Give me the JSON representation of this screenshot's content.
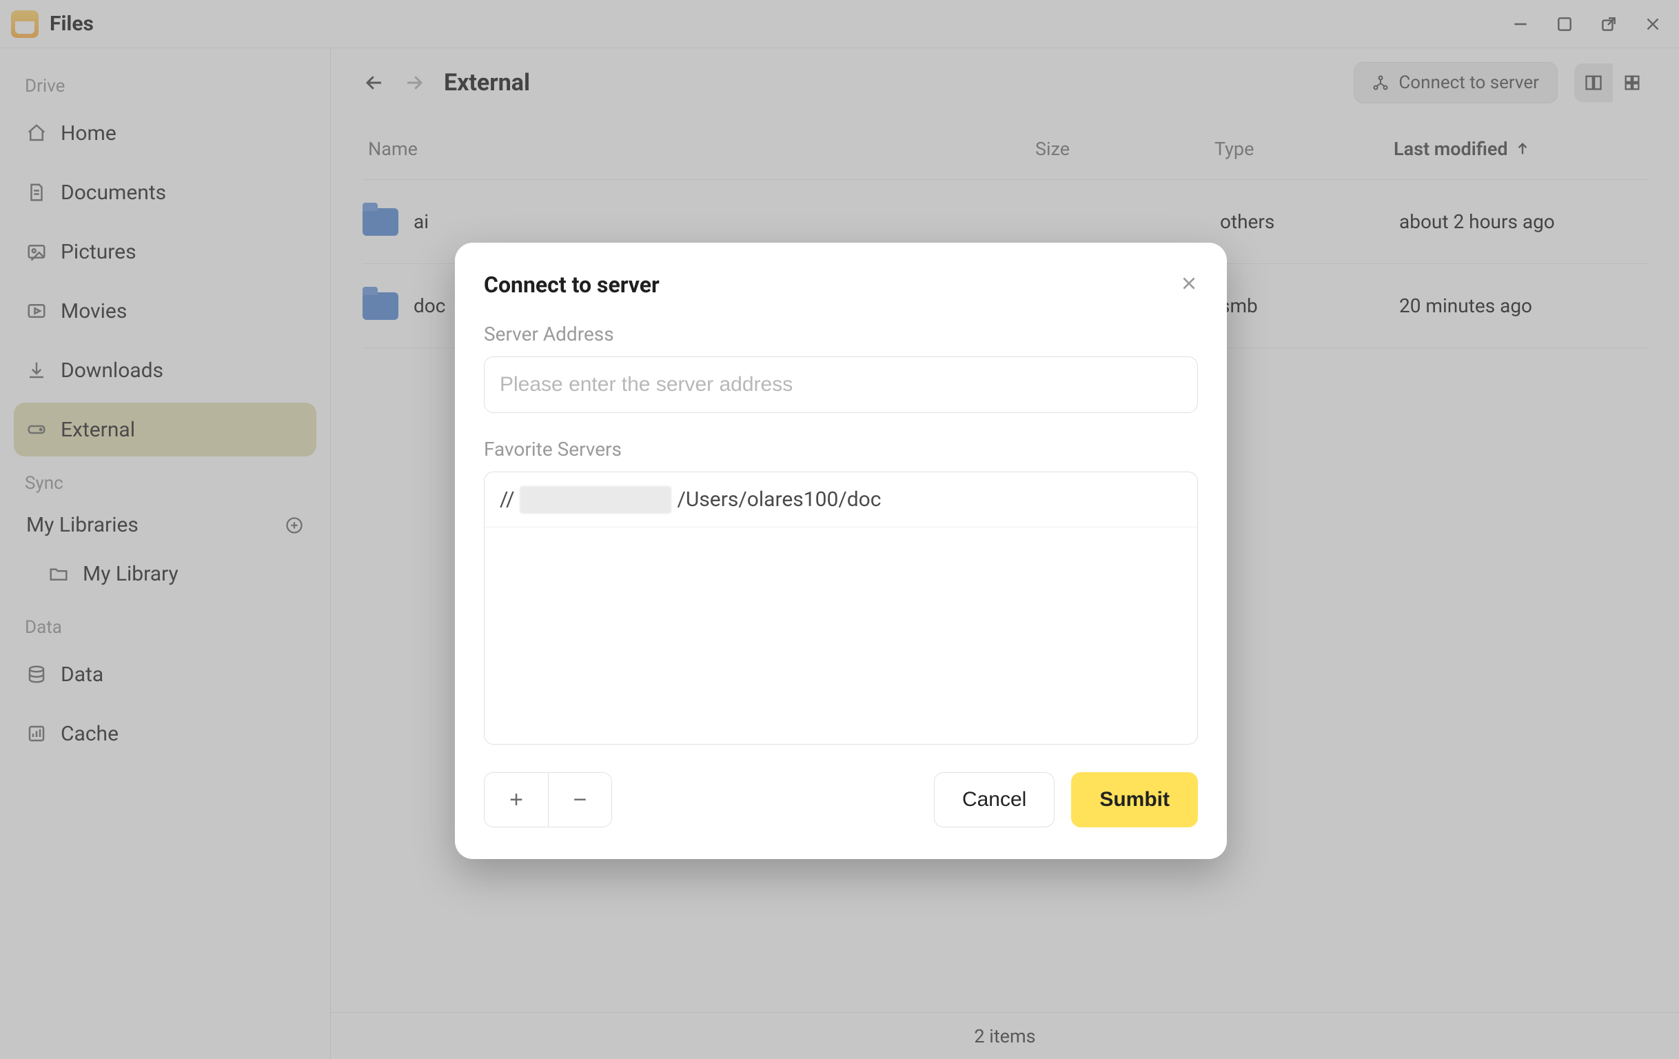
{
  "app": {
    "title": "Files"
  },
  "sidebar": {
    "sections": {
      "drive": {
        "label": "Drive",
        "items": [
          {
            "label": "Home"
          },
          {
            "label": "Documents"
          },
          {
            "label": "Pictures"
          },
          {
            "label": "Movies"
          },
          {
            "label": "Downloads"
          },
          {
            "label": "External"
          }
        ]
      },
      "sync": {
        "label": "Sync",
        "libraries_label": "My Libraries",
        "items": [
          {
            "label": "My Library"
          }
        ]
      },
      "data": {
        "label": "Data",
        "items": [
          {
            "label": "Data"
          },
          {
            "label": "Cache"
          }
        ]
      }
    }
  },
  "toolbar": {
    "current_folder": "External",
    "connect_label": "Connect to server"
  },
  "table": {
    "headers": {
      "name": "Name",
      "size": "Size",
      "type": "Type",
      "last_modified": "Last modified"
    },
    "rows": [
      {
        "name": "ai",
        "size": "",
        "type": "others",
        "last_modified": "about 2 hours ago"
      },
      {
        "name": "doc",
        "size": "",
        "type": "smb",
        "last_modified": "20 minutes ago"
      }
    ]
  },
  "statusbar": {
    "count_text": "2 items"
  },
  "modal": {
    "title": "Connect to server",
    "server_address_label": "Server Address",
    "server_address_placeholder": "Please enter the server address",
    "server_address_value": "",
    "favorite_label": "Favorite Servers",
    "favorites": [
      {
        "prefix": "//",
        "host_redacted": true,
        "suffix": "/Users/olares100/doc"
      }
    ],
    "add_label": "+",
    "remove_label": "−",
    "cancel": "Cancel",
    "submit": "Sumbit"
  }
}
